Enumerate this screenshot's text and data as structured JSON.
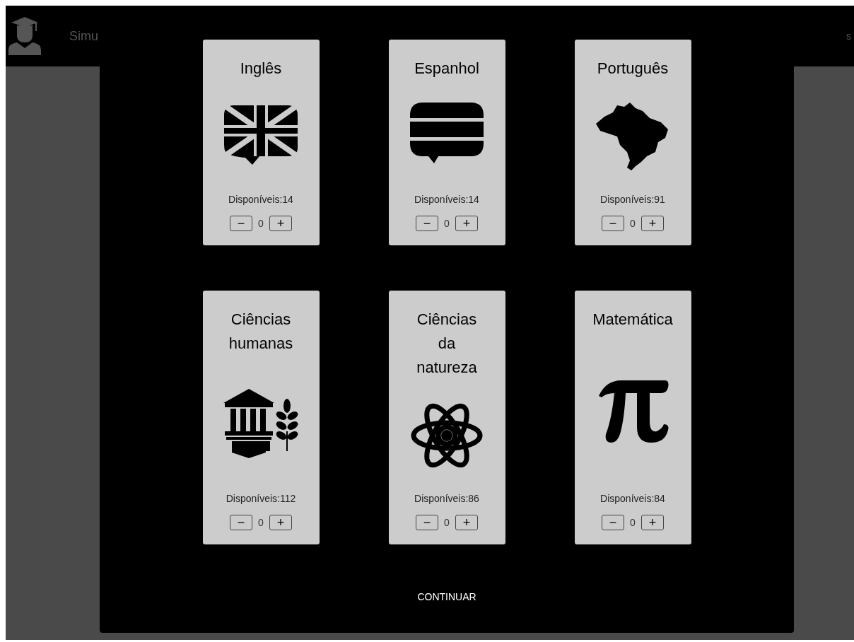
{
  "header": {
    "title": "Simu",
    "right_text": "s"
  },
  "subjects": [
    {
      "kind": "uk",
      "title_lines": [
        "Inglês"
      ],
      "available": "Disponíveis:14",
      "decrement": "−",
      "count": "0",
      "increment": "+"
    },
    {
      "kind": "spain",
      "title_lines": [
        "Espanhol"
      ],
      "available": "Disponíveis:14",
      "decrement": "−",
      "count": "0",
      "increment": "+"
    },
    {
      "kind": "brazil",
      "title_lines": [
        "Português"
      ],
      "available": "Disponíveis:91",
      "decrement": "−",
      "count": "0",
      "increment": "+"
    },
    {
      "kind": "humanities",
      "title_lines": [
        "Ciências",
        "humanas"
      ],
      "available": "Disponíveis:112",
      "decrement": "−",
      "count": "0",
      "increment": "+"
    },
    {
      "kind": "atom",
      "title_lines": [
        "Ciências",
        "da",
        "natureza"
      ],
      "available": "Disponíveis:86",
      "decrement": "−",
      "count": "0",
      "increment": "+"
    },
    {
      "kind": "pi",
      "title_lines": [
        "Matemática"
      ],
      "available": "Disponíveis:84",
      "decrement": "−",
      "count": "0",
      "increment": "+"
    }
  ],
  "continue_button": "CONTINUAR"
}
